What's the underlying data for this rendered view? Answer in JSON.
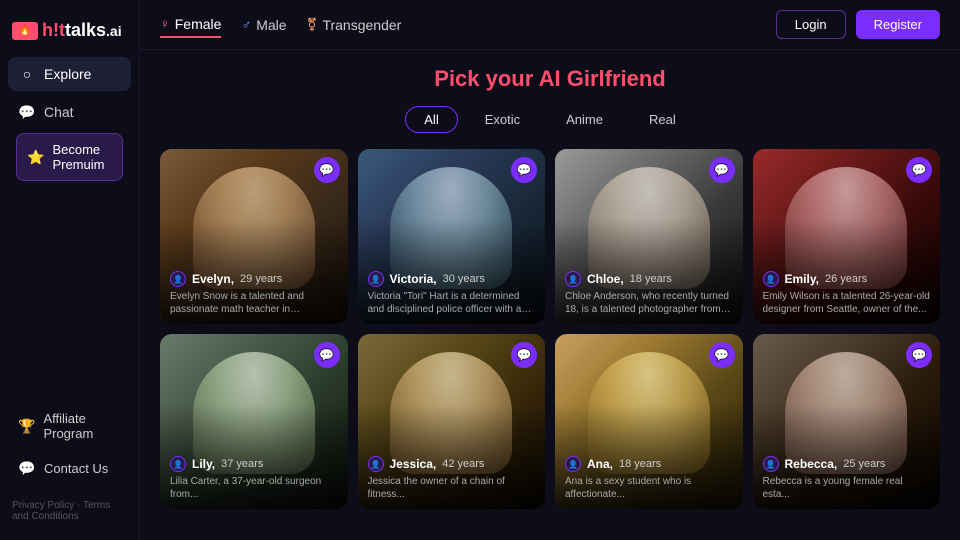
{
  "logo": {
    "hot": "h!t",
    "talks": "talks",
    "ai": ".ai"
  },
  "sidebar": {
    "items": [
      {
        "id": "explore",
        "label": "Explore",
        "icon": "○",
        "active": true
      },
      {
        "id": "chat",
        "label": "Chat",
        "icon": "💬",
        "active": false
      }
    ],
    "premium": {
      "label": "Become Premuim",
      "icon": "⭐"
    },
    "bottom": [
      {
        "id": "affiliate",
        "label": "Affiliate Program",
        "icon": "🏆"
      },
      {
        "id": "contact",
        "label": "Contact Us",
        "icon": "💬"
      }
    ],
    "footer": {
      "privacy": "Privacy Policy",
      "separator": " · ",
      "terms": "Terms and Conditions"
    }
  },
  "header": {
    "gender_tabs": [
      {
        "id": "female",
        "label": "Female",
        "icon": "♀",
        "active": true
      },
      {
        "id": "male",
        "label": "Male",
        "icon": "♂",
        "active": false
      },
      {
        "id": "transgender",
        "label": "Transgender",
        "icon": "⚧",
        "active": false
      }
    ],
    "auth": {
      "login": "Login",
      "register": "Register"
    }
  },
  "main": {
    "title_static": "Pick your AI ",
    "title_highlight": "Girlfriend",
    "filter_tabs": [
      {
        "id": "all",
        "label": "All",
        "active": true
      },
      {
        "id": "exotic",
        "label": "Exotic",
        "active": false
      },
      {
        "id": "anime",
        "label": "Anime",
        "active": false
      },
      {
        "id": "real",
        "label": "Real",
        "active": false
      }
    ],
    "cards": [
      {
        "id": "evelyn",
        "name": "Evelyn,",
        "age": "29 years",
        "desc": "Evelyn Snow is a talented and passionate math teacher in Vancouver,...",
        "photo_class": "card-photo-1"
      },
      {
        "id": "victoria",
        "name": "Victoria,",
        "age": "30 years",
        "desc": "Victoria \"Tori\" Hart is a determined and disciplined police officer with a passion...",
        "photo_class": "card-photo-2"
      },
      {
        "id": "chloe",
        "name": "Chloe,",
        "age": "18 years",
        "desc": "Chloe Anderson, who recently turned 18, is a talented photographer from Sydne...",
        "photo_class": "card-photo-3"
      },
      {
        "id": "emily",
        "name": "Emily,",
        "age": "26 years",
        "desc": "Emily Wilson is a talented 26-year-old designer from Seattle, owner of the...",
        "photo_class": "card-photo-4"
      },
      {
        "id": "lily",
        "name": "Lily,",
        "age": "37 years",
        "desc": "Lilia Carter, a 37-year-old surgeon from...",
        "photo_class": "card-photo-5"
      },
      {
        "id": "jessica",
        "name": "Jessica,",
        "age": "42 years",
        "desc": "Jessica the owner of a chain of fitness...",
        "photo_class": "card-photo-6"
      },
      {
        "id": "ana",
        "name": "Ana,",
        "age": "18 years",
        "desc": "Ana is a sexy student who is affectionate...",
        "photo_class": "card-photo-7"
      },
      {
        "id": "rebecca",
        "name": "Rebecca,",
        "age": "25 years",
        "desc": "Rebecca is a young female real esta...",
        "photo_class": "card-photo-8"
      }
    ]
  }
}
